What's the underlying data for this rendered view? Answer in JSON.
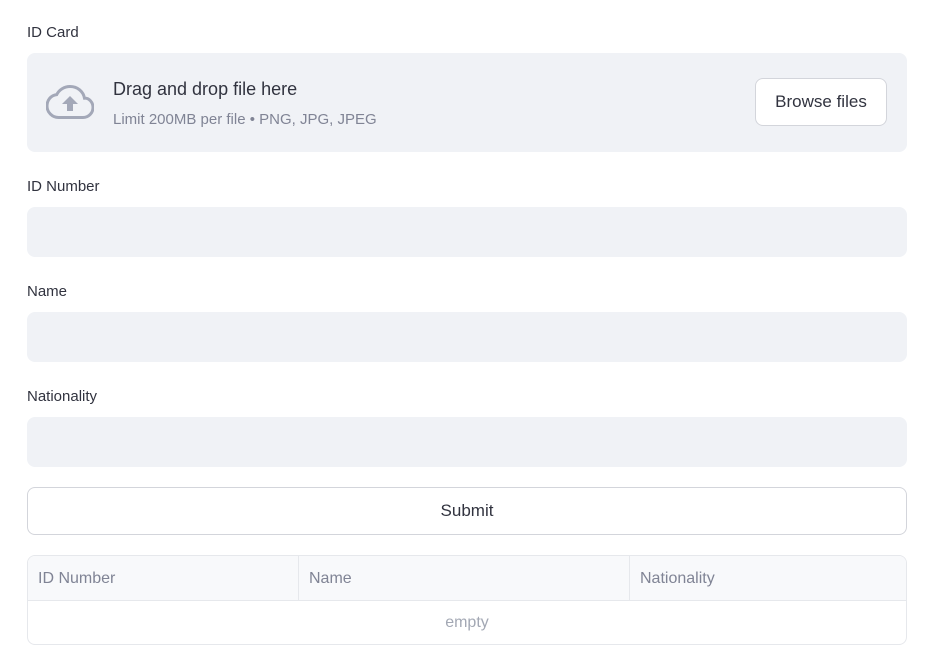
{
  "uploader": {
    "label": "ID Card",
    "title": "Drag and drop file here",
    "subtitle": "Limit 200MB per file • PNG, JPG, JPEG",
    "browse_label": "Browse files",
    "icon": "cloud-upload-icon"
  },
  "fields": {
    "id_number": {
      "label": "ID Number",
      "value": ""
    },
    "name": {
      "label": "Name",
      "value": ""
    },
    "nationality": {
      "label": "Nationality",
      "value": ""
    }
  },
  "submit_label": "Submit",
  "table": {
    "columns": [
      "ID Number",
      "Name",
      "Nationality"
    ],
    "empty_text": "empty"
  },
  "colors": {
    "input_bg": "#f0f2f6",
    "muted_text": "#808495",
    "text": "#31333f"
  }
}
